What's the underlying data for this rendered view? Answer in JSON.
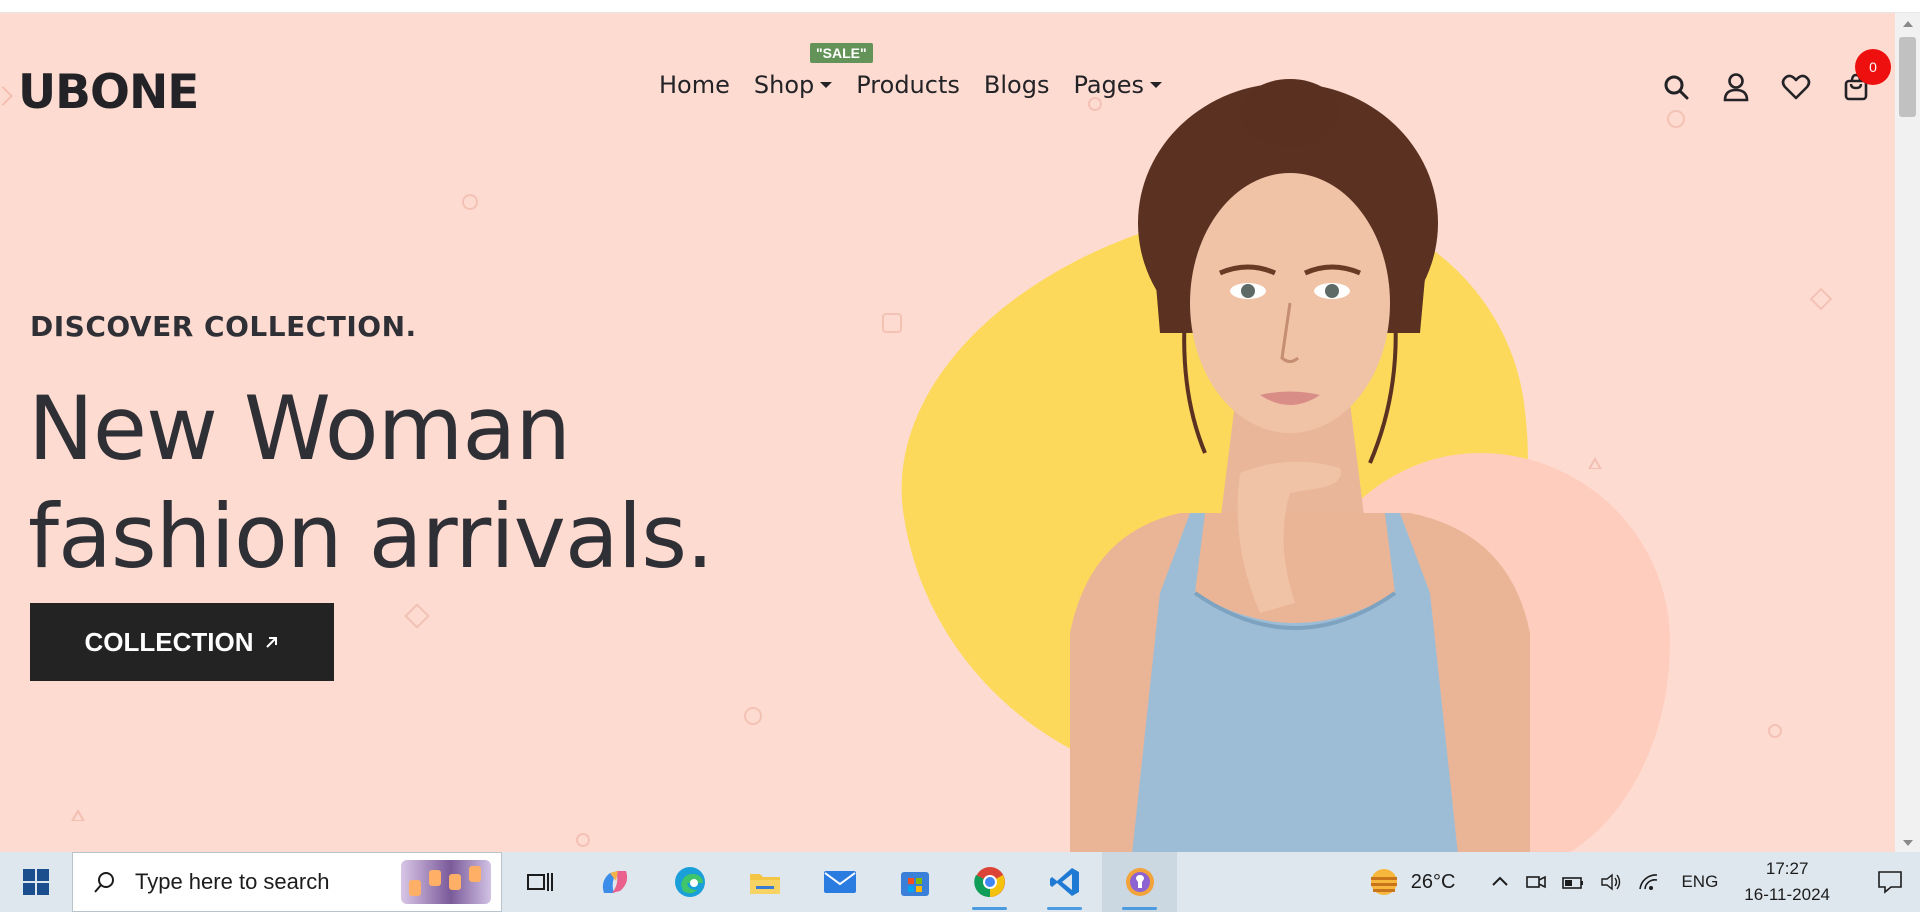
{
  "site": {
    "logo_text": "UBONE",
    "nav": {
      "home": "Home",
      "shop": "Shop",
      "products": "Products",
      "blogs": "Blogs",
      "pages": "Pages",
      "sale_badge": "\"SALE\""
    },
    "header_icons": [
      "search-icon",
      "user-icon",
      "heart-icon",
      "shopping-bag-icon"
    ],
    "cart_count": "0"
  },
  "hero": {
    "eyebrow": "DISCOVER COLLECTION.",
    "headline_line1": "New Woman",
    "headline_line2": "fashion arrivals.",
    "cta_label": "COLLECTION",
    "colors": {
      "background": "#fedbd1",
      "blob_yellow": "#fcd95b",
      "blob_pink": "#ffcdbd",
      "text": "#2f2f36",
      "cta_bg": "#232323",
      "sale_green": "#64935a",
      "cart_badge": "#ee0f0f"
    }
  },
  "taskbar": {
    "search_placeholder": "Type here to search",
    "apps": [
      "task-view-icon",
      "copilot-icon",
      "edge-icon",
      "file-explorer-icon",
      "mail-icon",
      "store-icon",
      "chrome-icon",
      "vscode-icon",
      "brave-icon"
    ],
    "weather": "26°C",
    "language": "ENG",
    "time": "17:27",
    "date": "16-11-2024"
  }
}
